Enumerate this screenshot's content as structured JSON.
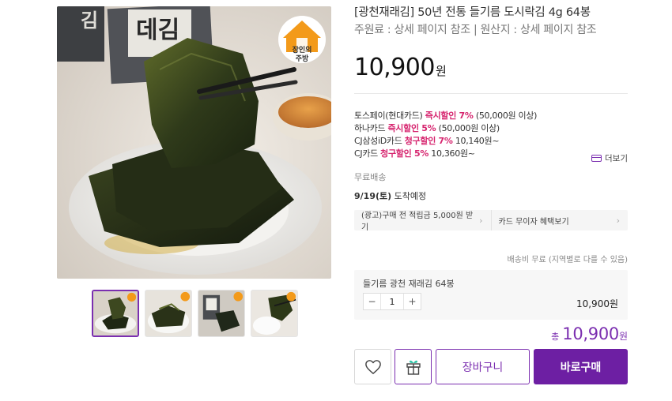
{
  "product": {
    "title": "[광천재래김] 50년 전통 들기름 도시락김 4g 64봉",
    "origin": "주원료 : 상세 페이지 참조 | 원산지 : 상세 페이지 참조",
    "price": "10,900",
    "currency": "원",
    "badge_line1": "장인의",
    "badge_line2": "주방",
    "package_text_1": "김",
    "package_text_2": "데김"
  },
  "promotions": [
    {
      "prefix": "토스페이(현대카드) ",
      "highlight": "즉시할인 7%",
      "suffix": " (50,000원 이상)"
    },
    {
      "prefix": "하나카드 ",
      "highlight": "즉시할인 5%",
      "suffix": " (50,000원 이상)"
    },
    {
      "prefix": "CJ삼성iD카드 ",
      "highlight": "청구할인 7%",
      "suffix": " 10,140원~"
    },
    {
      "prefix": "CJ카드 ",
      "highlight": "청구할인 5%",
      "suffix": " 10,360원~"
    }
  ],
  "more_label": "더보기",
  "shipping_label": "무료배송",
  "arrival": {
    "date": "9/19(토)",
    "label": " 도착예정"
  },
  "benefits": {
    "left": "(광고)구매 전 적립금 5,000원 받기",
    "right": "카드 무이자 혜택보기",
    "chevron": "›"
  },
  "ship_note": "배송비 무료 (지역별로 다를 수 있음)",
  "option": {
    "name": "들기름 광천 재래김 64봉",
    "qty": "1",
    "minus": "−",
    "plus": "+",
    "price": "10,900원"
  },
  "total": {
    "label": "총",
    "value": "10,900",
    "unit": "원"
  },
  "buttons": {
    "wish_icon": "heart-icon",
    "gift_icon": "gift-icon",
    "cart": "장바구니",
    "buy": "바로구매"
  },
  "colors": {
    "accent": "#7b2fb0",
    "buy_bg": "#6d1fa3",
    "promo_highlight": "#d6246e"
  }
}
